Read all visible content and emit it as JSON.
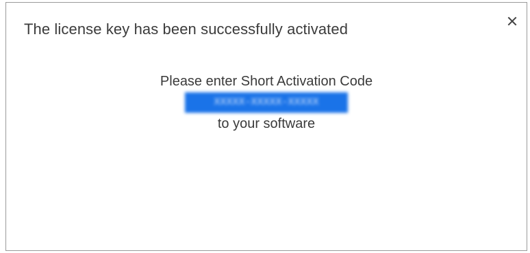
{
  "dialog": {
    "title": "The license key has been successfully activated",
    "close_icon": "close-icon",
    "message_line1": "Please enter Short Activation Code",
    "activation_code": "XXXXX-XXXXX-XXXXX",
    "message_line2": "to your software"
  },
  "colors": {
    "code_highlight": "#1a73e8",
    "text": "#3a3a3a",
    "border": "#9a9a9a"
  }
}
